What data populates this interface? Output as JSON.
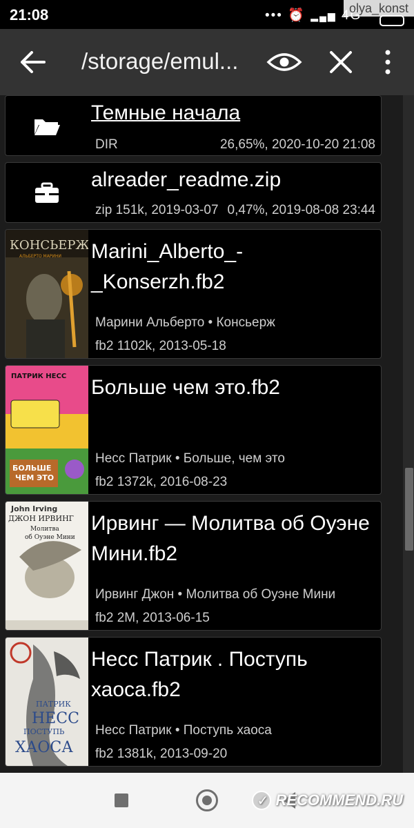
{
  "status_bar": {
    "time": "21:08",
    "icons_text": "•••",
    "network": "4G",
    "user_badge": "olya_konst"
  },
  "toolbar": {
    "path": "/storage/emul...",
    "icons": [
      "arrow-left",
      "eye",
      "close",
      "more-vertical"
    ]
  },
  "files": [
    {
      "kind": "folder",
      "icon": "folder-icon",
      "name": "Темные начала",
      "meta_left": "DIR",
      "meta_right": "26,65%, 2020-10-20 21:08"
    },
    {
      "kind": "archive",
      "icon": "briefcase-icon",
      "name": "alreader_readme.zip",
      "meta_left": "zip  151k, 2019-03-07",
      "meta_right": "0,47%, 2019-08-08 23:44"
    }
  ],
  "books": [
    {
      "file": "Marini_Alberto_-_Konserzh.fb2",
      "author_title": "Марини Альберто • Консьерж",
      "meta": "fb2  1102k, 2013-05-18",
      "cover_text": [
        "КОНСЬЕРЖ",
        "АЛЬБЕРТО МАРИНИ"
      ]
    },
    {
      "file": "Больше чем это.fb2",
      "author_title": "Несс Патрик • Больше, чем это",
      "meta": "fb2  1372k, 2016-08-23",
      "cover_text": [
        "ПАТРИК НЕСС",
        "БОЛЬШЕ",
        "ЧЕМ ЭТО"
      ]
    },
    {
      "file": "Ирвинг — Молитва об Оуэне Мини.fb2",
      "author_title": "Ирвинг Джон • Молитва об Оуэне Мини",
      "meta": "fb2  2M, 2013-06-15",
      "cover_text": [
        "John Irving",
        "ДЖОН ИРВИНГ",
        "Молитва",
        "об Оуэне Мини"
      ]
    },
    {
      "file": "Несс Патрик . Поступь хаоса.fb2",
      "author_title": "Несс Патрик • Поступь хаоса",
      "meta": "fb2  1381k, 2013-09-20",
      "cover_text": [
        "ПАТРИК",
        "НЕСС",
        "ПОСТУПЬ",
        "ХАОСА"
      ]
    }
  ],
  "nav_bar": {
    "buttons": [
      "recents",
      "home",
      "back"
    ],
    "watermark": "RECOMMEND.RU"
  },
  "colors": {
    "background": "#1c1c1c",
    "toolbar": "#333333",
    "row": "#000000",
    "meta_text": "#cfcfcf",
    "nav_bar": "#f4f4f4"
  }
}
